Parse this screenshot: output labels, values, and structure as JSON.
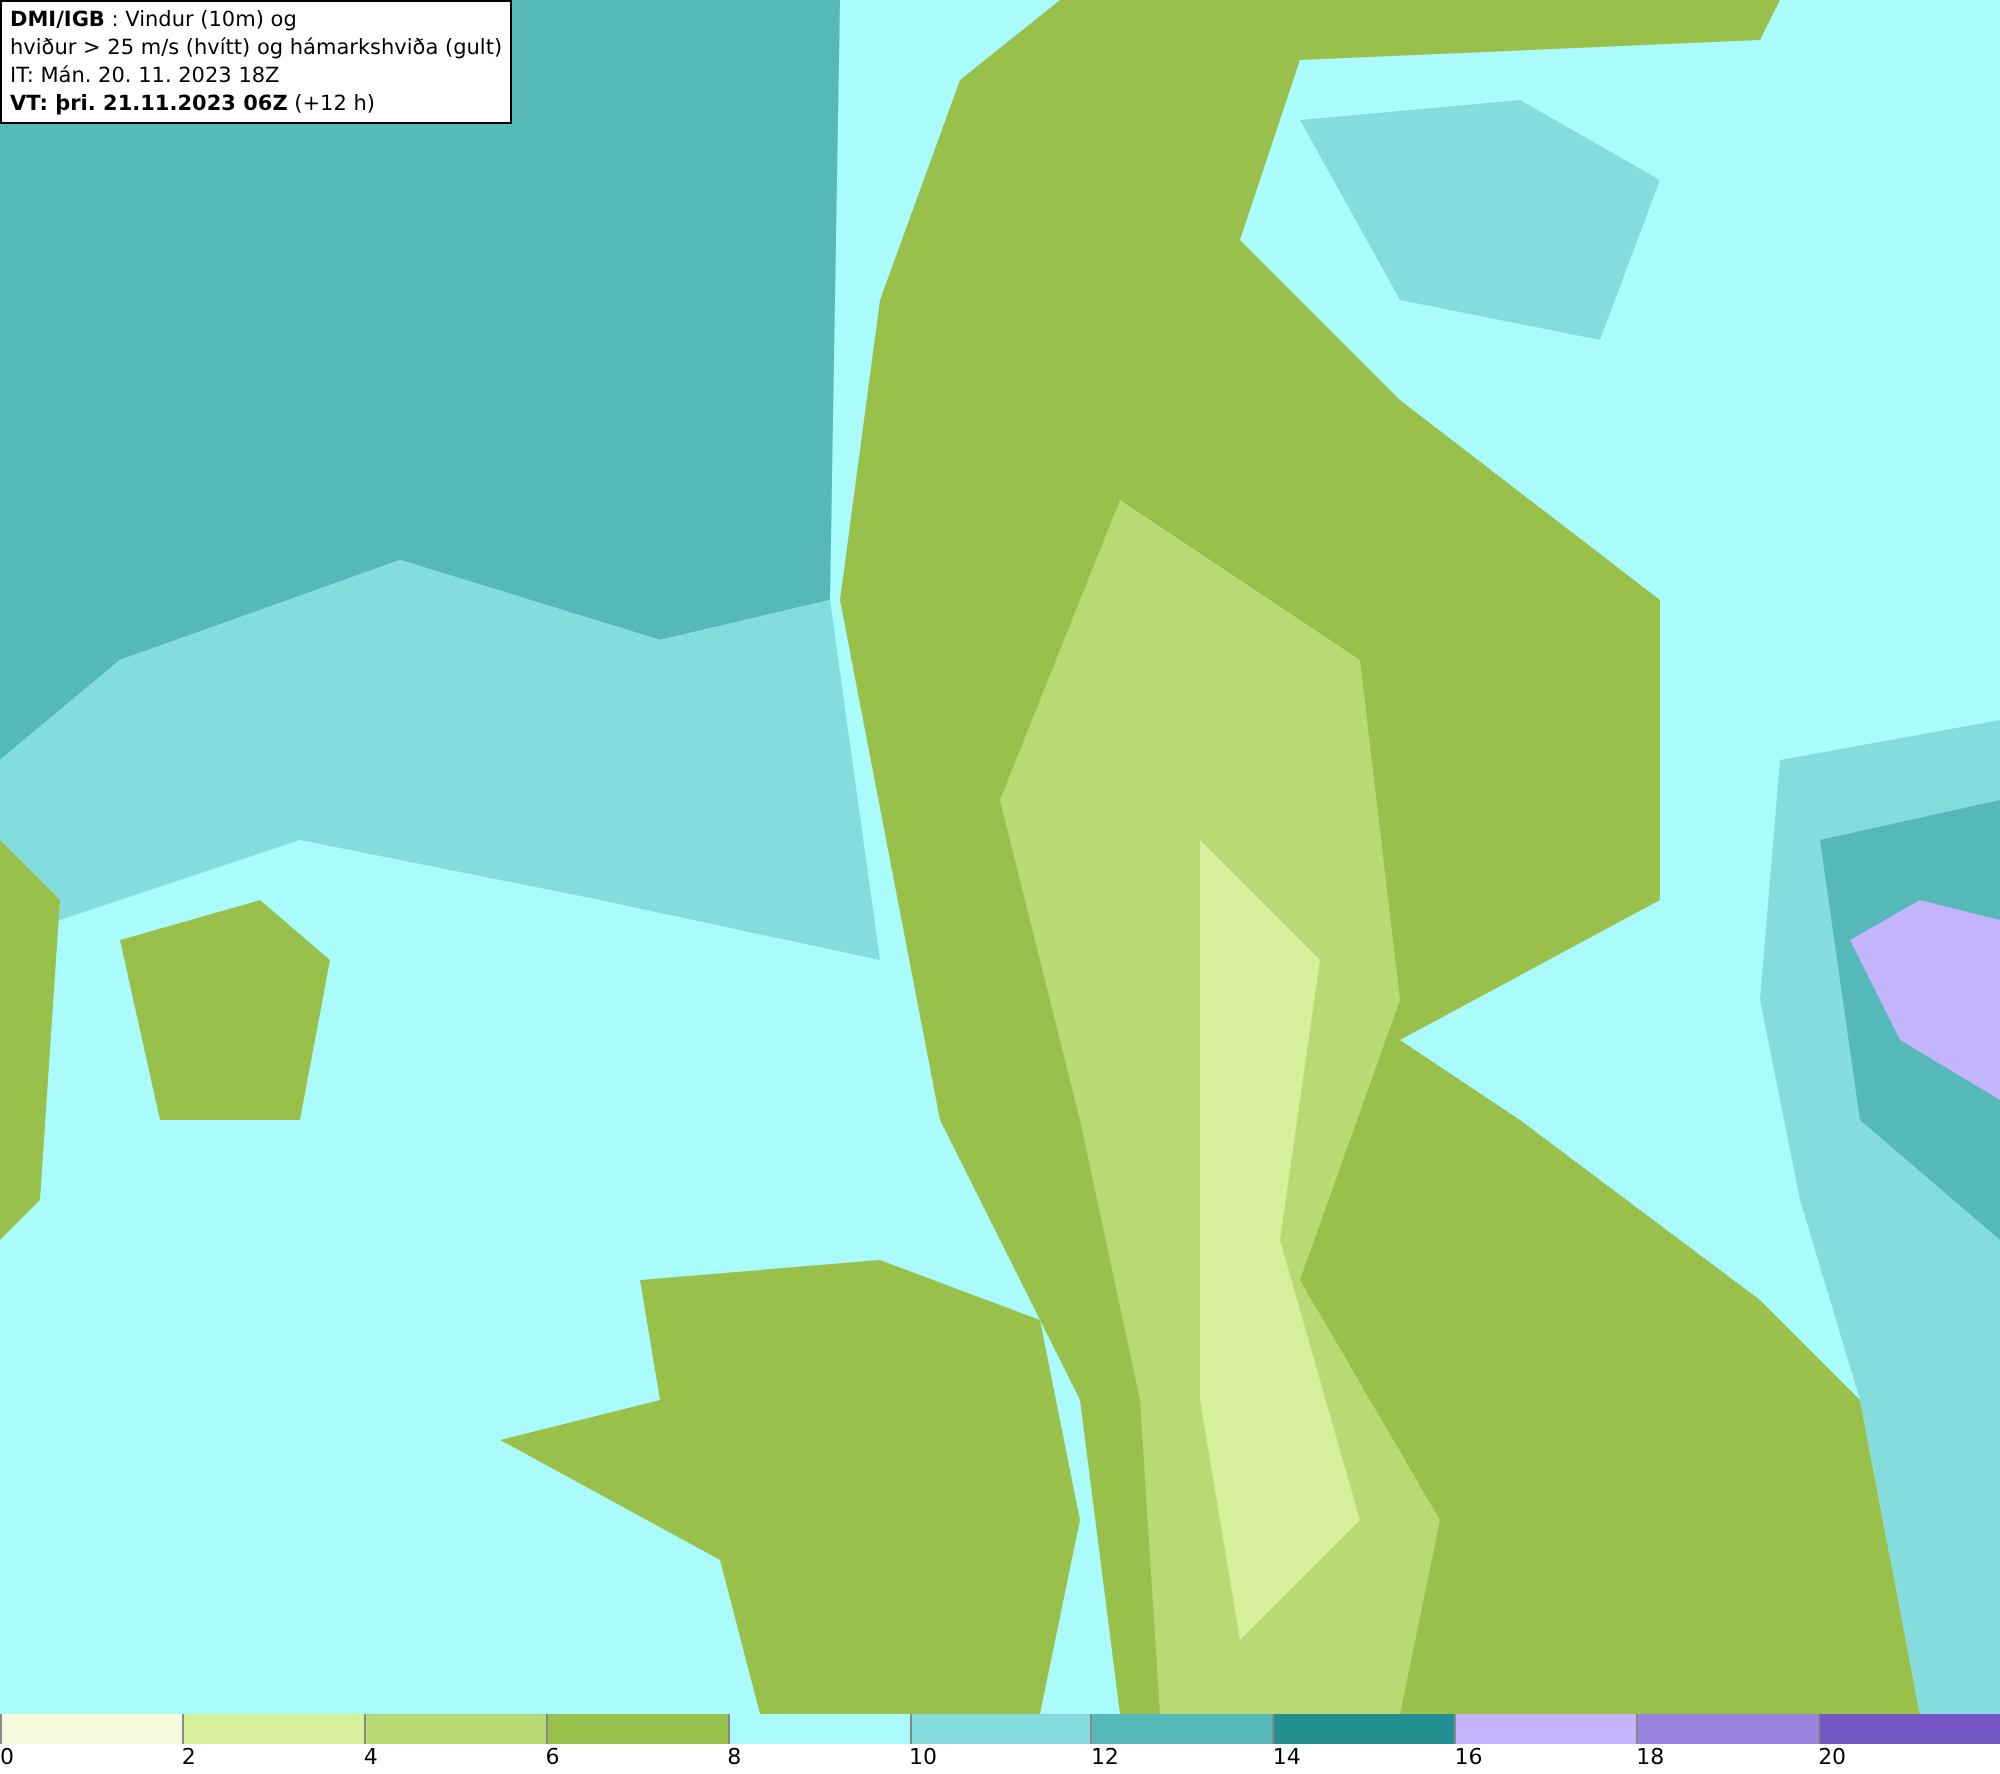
{
  "title_box": {
    "lines": [
      "**DMI/IGB** : Vindur (10m) og",
      "hviður > 25 m/s (hvítt) og hámarkshviða (gult)",
      "IT: Mán. 20. 11. 2023 18Z",
      "**VT: þri. 21.11.2023 06Z** (+12 h)"
    ]
  },
  "legend": [
    {
      "label": "0",
      "color": "#f4fadc"
    },
    {
      "label": "2",
      "color": "#d7f09c"
    },
    {
      "label": "4",
      "color": "#b8da74"
    },
    {
      "label": "6",
      "color": "#98c04a"
    },
    {
      "label": "8",
      "color": "#aafcfc"
    },
    {
      "label": "10",
      "color": "#84dcdc"
    },
    {
      "label": "12",
      "color": "#56b8b8"
    },
    {
      "label": "14",
      "color": "#229090"
    },
    {
      "label": "16",
      "color": "#c4b4fc"
    },
    {
      "label": "18",
      "color": "#9a84e0"
    },
    {
      "label": "20",
      "color": "#7456c4"
    }
  ]
}
